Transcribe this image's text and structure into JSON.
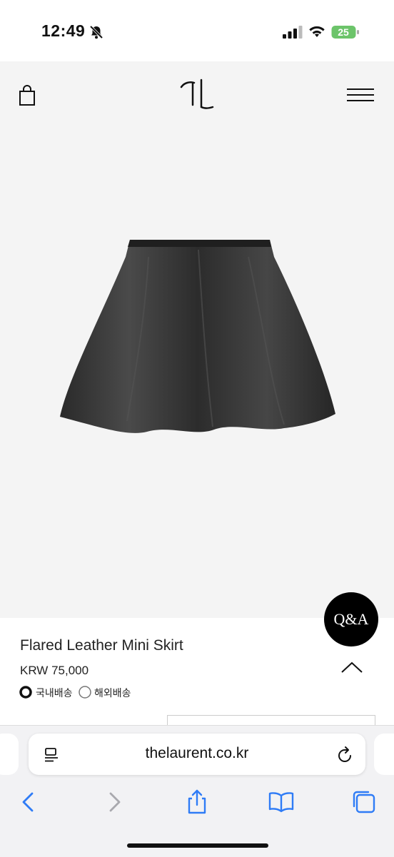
{
  "status_bar": {
    "time": "12:49",
    "battery": "25"
  },
  "site": {
    "logo_icon": "brand-monogram-icon",
    "bag_icon": "shopping-bag-icon",
    "menu_icon": "hamburger-menu-icon"
  },
  "product": {
    "name": "Flared Leather Mini Skirt",
    "price": "KRW 75,000",
    "shipping_options": [
      {
        "label": "국내배송",
        "selected": true
      },
      {
        "label": "해외배송",
        "selected": false
      }
    ]
  },
  "qa_button": {
    "label": "Q&A"
  },
  "browser": {
    "url": "thelaurent.co.kr",
    "toolbar": [
      "back-icon",
      "forward-icon",
      "share-icon",
      "bookmarks-icon",
      "tabs-icon"
    ]
  }
}
